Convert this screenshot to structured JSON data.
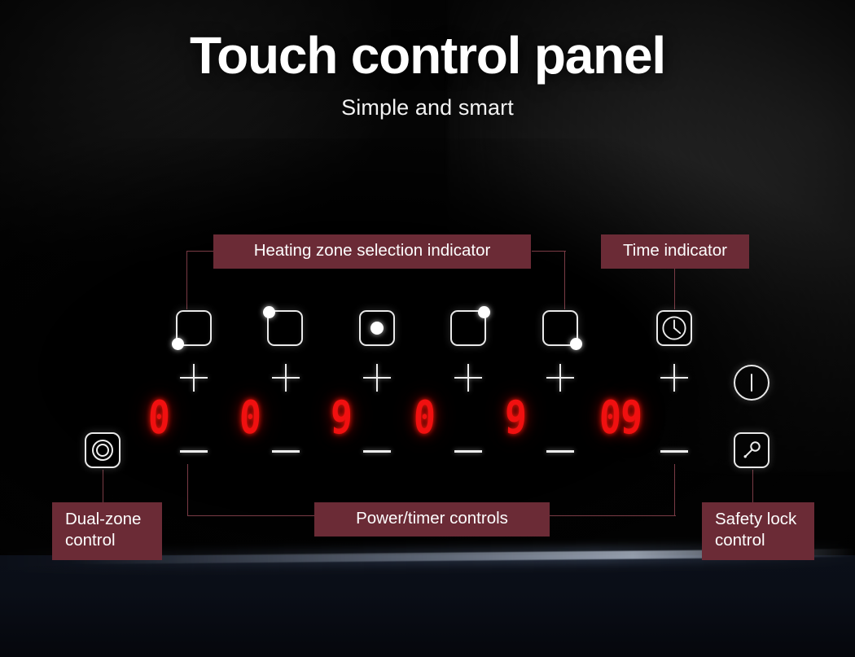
{
  "header": {
    "title": "Touch control panel",
    "subtitle": "Simple and smart"
  },
  "colors": {
    "tag_background": "#6b2b36",
    "tag_text": "#fdfdfd",
    "leader_line": "#7a3b45",
    "led_red": "#f01010",
    "icon_white": "#e9e9e9",
    "panel_black": "#050505"
  },
  "callouts": {
    "heating_zone": "Heating zone selection indicator",
    "time_indicator": "Time indicator",
    "dual_zone": "Dual-zone\ncontrol",
    "power_timer": "Power/timer controls",
    "safety_lock": "Safety lock\ncontrol"
  },
  "panel": {
    "zones": [
      {
        "name": "zone-1",
        "dot_position": "bottom-left",
        "icon": "cooking-zone-front-left-icon",
        "display": "0"
      },
      {
        "name": "zone-2",
        "dot_position": "top-left",
        "icon": "cooking-zone-rear-left-icon",
        "display": "0"
      },
      {
        "name": "zone-3",
        "dot_position": "center",
        "icon": "cooking-zone-center-icon",
        "display": "9"
      },
      {
        "name": "zone-4",
        "dot_position": "top-right",
        "icon": "cooking-zone-rear-right-icon",
        "display": "0"
      },
      {
        "name": "zone-5",
        "dot_position": "bottom-right",
        "icon": "cooking-zone-front-right-icon",
        "display": "9"
      },
      {
        "name": "timer",
        "dot_position": "none",
        "icon": "clock-icon",
        "display": "09"
      }
    ],
    "increase_label": "+",
    "decrease_label": "—",
    "power_icon": "power-icon",
    "lock_icon": "key-lock-icon",
    "dual_zone_icon": "dual-ring-icon",
    "clock_icon": "clock-icon"
  }
}
